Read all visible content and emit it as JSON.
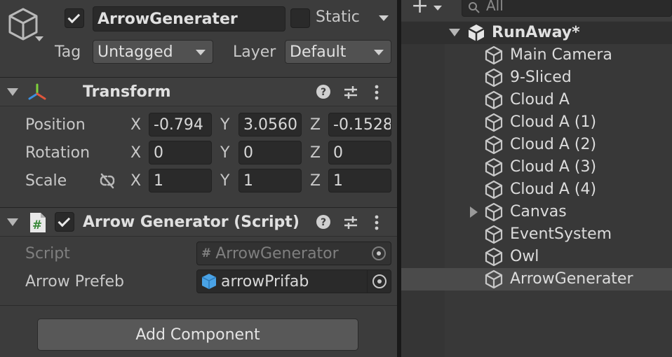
{
  "inspector": {
    "object_name": "ArrowGenerater",
    "active_checked": true,
    "static_label": "Static",
    "static_checked": false,
    "tag_label": "Tag",
    "tag_value": "Untagged",
    "layer_label": "Layer",
    "layer_value": "Default"
  },
  "transform": {
    "title": "Transform",
    "position_label": "Position",
    "rotation_label": "Rotation",
    "scale_label": "Scale",
    "x_label": "X",
    "y_label": "Y",
    "z_label": "Z",
    "position": {
      "x": "-0.794",
      "y": "3.0560",
      "z": "-0.1528"
    },
    "rotation": {
      "x": "0",
      "y": "0",
      "z": "0"
    },
    "scale": {
      "x": "1",
      "y": "1",
      "z": "1"
    }
  },
  "script_component": {
    "title": "Arrow Generator (Script)",
    "enabled": true,
    "script_label": "Script",
    "script_value": "ArrowGenerator",
    "arrow_prefab_label": "Arrow Prefeb",
    "arrow_prefab_value": "arrowPrifab"
  },
  "add_component_label": "Add Component",
  "hierarchy": {
    "search_placeholder": "All",
    "scene_name": "RunAway*",
    "items": [
      {
        "label": "Main Camera",
        "selected": false,
        "has_children": false
      },
      {
        "label": "9-Sliced",
        "selected": false,
        "has_children": false
      },
      {
        "label": "Cloud A",
        "selected": false,
        "has_children": false
      },
      {
        "label": "Cloud A (1)",
        "selected": false,
        "has_children": false
      },
      {
        "label": "Cloud A (2)",
        "selected": false,
        "has_children": false
      },
      {
        "label": "Cloud A (3)",
        "selected": false,
        "has_children": false
      },
      {
        "label": "Cloud A (4)",
        "selected": false,
        "has_children": false
      },
      {
        "label": "Canvas",
        "selected": false,
        "has_children": true
      },
      {
        "label": "EventSystem",
        "selected": false,
        "has_children": false
      },
      {
        "label": "Owl",
        "selected": false,
        "has_children": false
      },
      {
        "label": "ArrowGenerater",
        "selected": true,
        "has_children": false
      }
    ]
  },
  "colors": {
    "panel_bg": "#3c3c3c",
    "field_bg": "#2a2a2a",
    "selection_bg": "#4b4b4b",
    "text": "#d2d2d2"
  },
  "icons": [
    "gameobject-cube-icon",
    "transform-axis-icon",
    "script-hash-icon",
    "help-icon",
    "preset-sliders-icon",
    "kebab-menu-icon",
    "unlink-icon",
    "object-picker-icon",
    "prefab-cube-icon",
    "unity-scene-icon",
    "plus-icon",
    "search-icon"
  ]
}
